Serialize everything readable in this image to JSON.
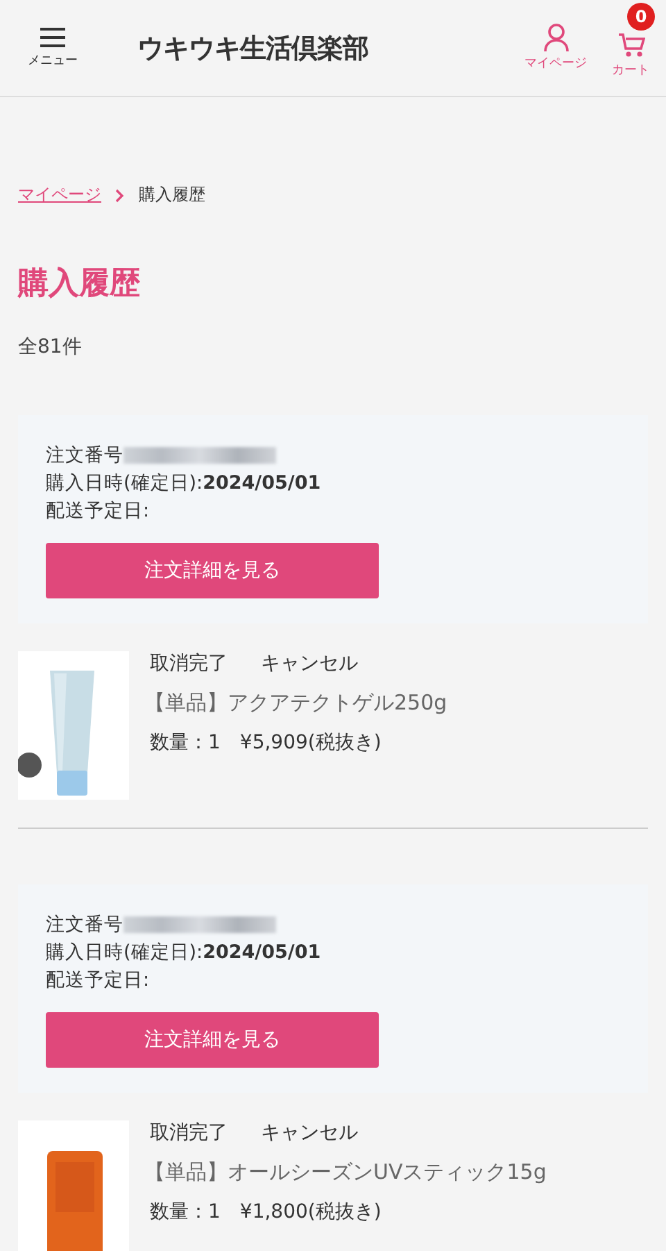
{
  "header": {
    "menu_label": "メニュー",
    "logo": "ウキウキ生活倶楽部",
    "mypage_label": "マイページ",
    "cart_label": "カート",
    "cart_count": "0"
  },
  "breadcrumb": [
    {
      "label": "マイページ",
      "link": true
    },
    {
      "label": "購入履歴",
      "link": false
    }
  ],
  "title": "購入履歴",
  "total": "全81件",
  "orders": [
    {
      "order_number_label": "注文番号",
      "purchase_date": "購入日時(確定日):**2024/05/01**",
      "delivery_date": "配送予定日:",
      "button": "注文詳細を見る",
      "item": {
        "kind": "tube",
        "status": "取消完了",
        "cancel": "キャンセル",
        "name": "【単品】アクアテクトゲル250g",
        "quantity_price": "数量：1　¥5,909(税抜き)"
      }
    },
    {
      "order_number_label": "注文番号",
      "purchase_date": "購入日時(確定日):**2024/05/01**",
      "delivery_date": "配送予定日:",
      "button": "注文詳細を見る",
      "item": {
        "kind": "stick",
        "status": "取消完了",
        "cancel": "キャンセル",
        "name": "【単品】オールシーズンUVスティック15g",
        "quantity_price": "数量：1　¥1,800(税抜き)"
      }
    }
  ]
}
